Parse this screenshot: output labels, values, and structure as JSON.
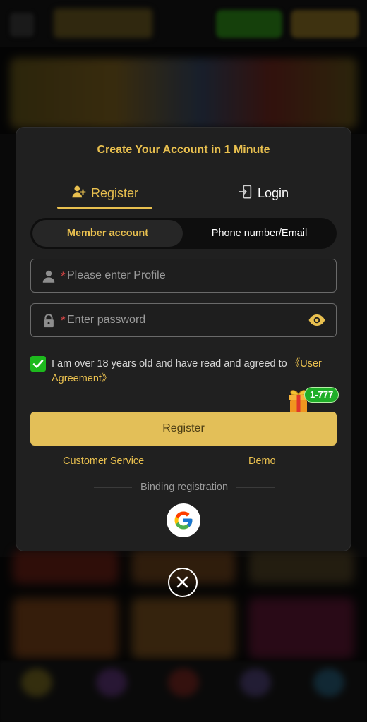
{
  "modal": {
    "title": "Create Your Account in 1 Minute",
    "tabs": [
      {
        "label": "Register",
        "active": true
      },
      {
        "label": "Login",
        "active": false
      }
    ],
    "account_types": [
      {
        "label": "Member account",
        "selected": true
      },
      {
        "label": "Phone number/Email",
        "selected": false
      }
    ],
    "fields": {
      "profile": {
        "required_mark": "*",
        "placeholder": "Please enter Profile",
        "value": ""
      },
      "password": {
        "required_mark": "*",
        "placeholder": "Enter password",
        "value": ""
      }
    },
    "agreement": {
      "checked": true,
      "text": "I am over 18 years old and have read and agreed to ",
      "link": "《User Agreement》"
    },
    "gift_badge": "1-777",
    "register_button": "Register",
    "links": {
      "customer_service": "Customer Service",
      "demo": "Demo"
    },
    "binding_label": "Binding registration",
    "social": [
      "google-icon"
    ]
  },
  "colors": {
    "accent": "#e9c04f",
    "button": "#e3bf58",
    "modal_bg": "#202020",
    "check": "#1db91d",
    "badge": "#1fae28",
    "required": "#e04646"
  }
}
